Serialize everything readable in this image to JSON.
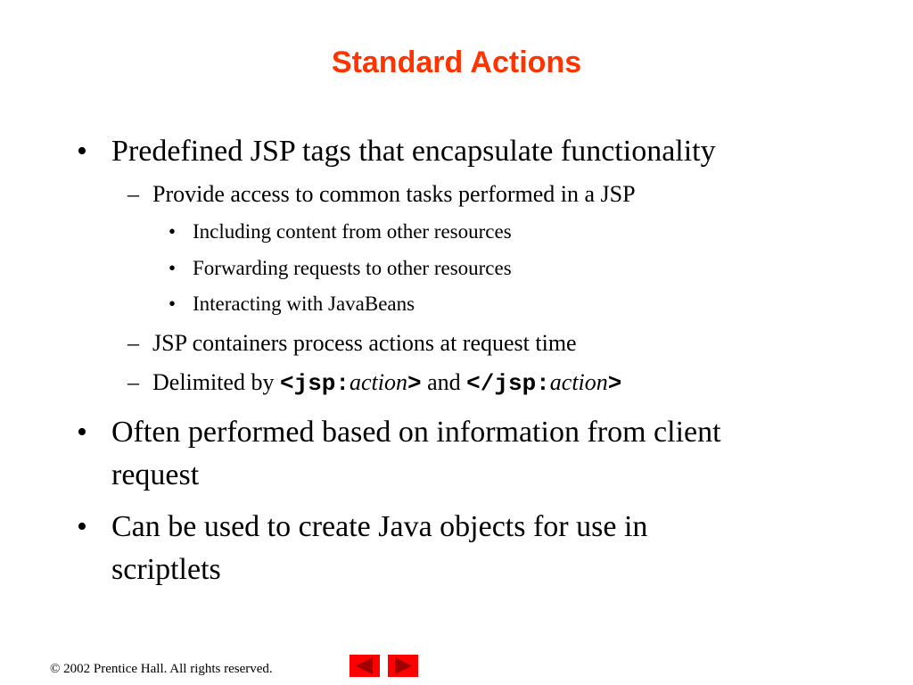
{
  "slide": {
    "title": "Standard Actions",
    "bullets": [
      {
        "text": "Predefined JSP tags that encapsulate functionality",
        "sub": [
          {
            "text": "Provide access to common tasks performed in a JSP",
            "sub": [
              "Including content from other resources",
              "Forwarding requests to other resources",
              "Interacting with JavaBeans"
            ]
          },
          {
            "text": "JSP containers process actions at request time"
          },
          {
            "prefix": "Delimited by ",
            "open_tag_code": "<jsp:",
            "open_tag_italic": "action",
            "open_tag_end": ">",
            "middle": " and ",
            "close_tag_code": "</jsp:",
            "close_tag_italic": "action",
            "close_tag_end": ">"
          }
        ]
      },
      {
        "line1": "Often performed based on information from client",
        "line2": "request"
      },
      {
        "line1": "Can be used to create Java objects for use in",
        "line2": "scriptlets"
      }
    ],
    "bullet_glyph": "•",
    "dash_glyph": "–"
  },
  "footer": {
    "copyright": "© 2002 Prentice Hall.  All rights reserved.",
    "prev_icon": "triangle-left-icon",
    "next_icon": "triangle-right-icon",
    "nav_color": "#ff0000",
    "nav_arrow_color": "#a00000"
  },
  "colors": {
    "title": "#ff3300"
  }
}
